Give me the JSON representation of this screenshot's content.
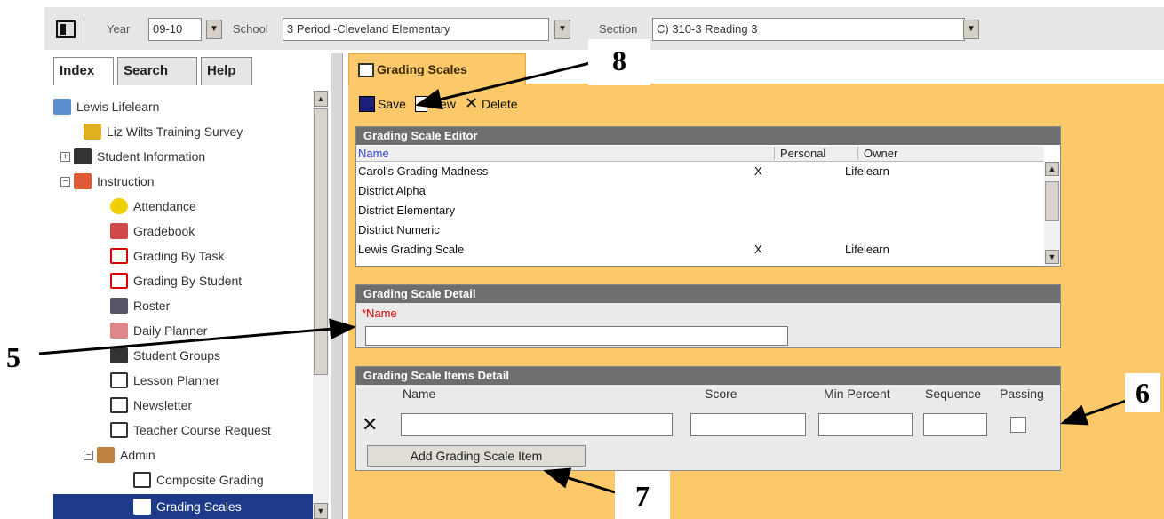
{
  "toolbar": {
    "year_label": "Year",
    "year_value": "09-10",
    "school_label": "School",
    "school_value": "3 Period -Cleveland Elementary",
    "section_label": "Section",
    "section_value": "C) 310-3 Reading 3"
  },
  "nav_tabs": [
    "Index",
    "Search",
    "Help"
  ],
  "tree": [
    "Lewis Lifelearn",
    "Liz Wilts Training Survey",
    "Student Information",
    "Instruction",
    "Attendance",
    "Gradebook",
    "Grading By Task",
    "Grading By Student",
    "Roster",
    "Daily Planner",
    "Student Groups",
    "Lesson Planner",
    "Newsletter",
    "Teacher Course Request",
    "Admin",
    "Composite Grading",
    "Grading Scales"
  ],
  "content_tab": "Grading Scales",
  "actions": {
    "save": "Save",
    "new": "New",
    "delete": "Delete"
  },
  "editor": {
    "title": "Grading Scale Editor",
    "columns": [
      "Name",
      "Personal",
      "Owner"
    ],
    "rows": [
      {
        "name": "Carol's Grading Madness",
        "personal": "X",
        "owner": "Lifelearn"
      },
      {
        "name": "District Alpha",
        "personal": "",
        "owner": ""
      },
      {
        "name": "District Elementary",
        "personal": "",
        "owner": ""
      },
      {
        "name": "District Numeric",
        "personal": "",
        "owner": ""
      },
      {
        "name": "Lewis Grading Scale",
        "personal": "X",
        "owner": "Lifelearn"
      }
    ]
  },
  "detail": {
    "title": "Grading Scale Detail",
    "name_label": "*Name",
    "name_value": ""
  },
  "items": {
    "title": "Grading Scale Items Detail",
    "columns": [
      "Name",
      "Score",
      "Min Percent",
      "Sequence",
      "Passing"
    ],
    "add_button": "Add Grading Scale Item"
  },
  "callouts": {
    "c5": "5",
    "c6": "6",
    "c7": "7",
    "c8": "8"
  }
}
